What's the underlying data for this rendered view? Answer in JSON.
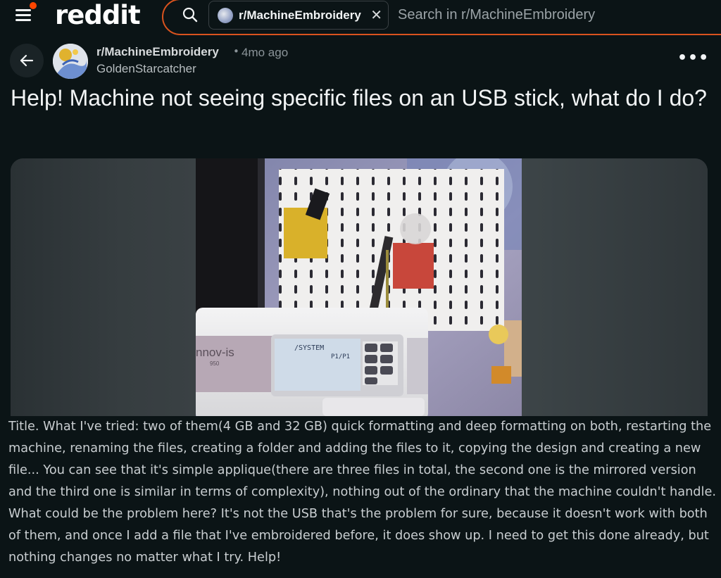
{
  "header": {
    "logo_text": "reddit",
    "community_chip": "r/MachineEmbroidery",
    "search_placeholder": "Search in r/MachineEmbroidery",
    "accent_color": "#ff4500"
  },
  "post": {
    "subreddit": "r/MachineEmbroidery",
    "age": "4mo ago",
    "separator": "•",
    "author": "GoldenStarcatcher",
    "more_label": "•••",
    "title": "Help! Machine not seeing specific files on an USB stick, what do I do?",
    "body": "Title. What I've tried: two of them(4 GB and 32 GB) quick formatting and deep formatting on both, restarting the machine, renaming the files, creating a folder and adding the files to it, copying the design and creating a new file... You can see that it's simple applique(there are three files in total, the second one is the mirrored version and the third one is similar in terms of complexity), nothing out of the ordinary that the machine couldn't handle. What could be the problem here? It's not the USB that's the problem for sure, because it doesn't work with both of them, and once I add a file that I've embroidered before, it does show up. I need to get this done already, but nothing changes no matter what I try. Help!"
  },
  "media": {
    "machine_brand": "nnov-is",
    "machine_model": "950",
    "screen_path": "/SYSTEM",
    "screen_page": "P1/P1"
  },
  "icons": {
    "menu": "hamburger-menu-icon",
    "search": "search-icon",
    "close": "close-icon",
    "back": "arrow-left-icon",
    "more": "more-options-icon"
  }
}
